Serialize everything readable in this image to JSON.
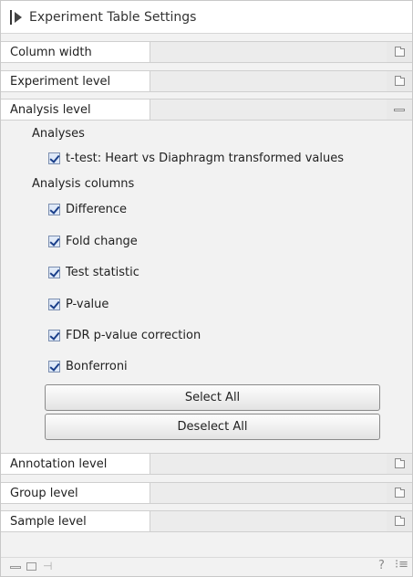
{
  "panel": {
    "title": "Experiment Table Settings"
  },
  "levels": {
    "column_width": "Column width",
    "experiment_level": "Experiment level",
    "analysis_level": "Analysis level",
    "annotation_level": "Annotation level",
    "group_level": "Group level",
    "sample_level": "Sample level"
  },
  "analysis": {
    "analyses_heading": "Analyses",
    "analyses": [
      {
        "label": "t-test: Heart vs Diaphragm transformed values",
        "checked": true
      }
    ],
    "columns_heading": "Analysis columns",
    "columns": [
      {
        "label": "Difference",
        "checked": true
      },
      {
        "label": "Fold change",
        "checked": true
      },
      {
        "label": "Test statistic",
        "checked": true
      },
      {
        "label": "P-value",
        "checked": true
      },
      {
        "label": "FDR p-value correction",
        "checked": true
      },
      {
        "label": "Bonferroni",
        "checked": true
      }
    ],
    "select_all": "Select All",
    "deselect_all": "Deselect All"
  },
  "footer": {
    "help": "?",
    "menu": "⁝≡"
  }
}
